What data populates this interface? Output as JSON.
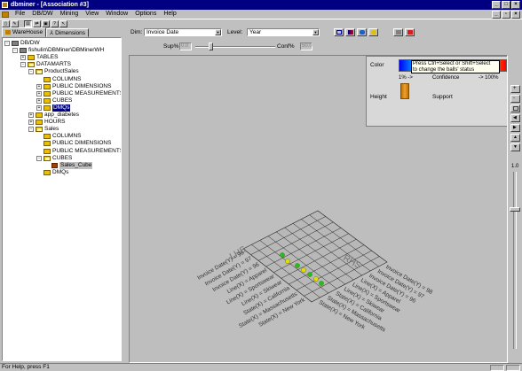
{
  "window": {
    "title": "dbminer - [Association #3]"
  },
  "menu": [
    "File",
    "DB/DW",
    "Mining",
    "View",
    "Window",
    "Options",
    "Help"
  ],
  "left_tabs": [
    "WareHouse",
    "Dimensions"
  ],
  "tree": [
    {
      "label": "DB/DW",
      "indent": 0,
      "exp": "-",
      "icon": "db"
    },
    {
      "label": "fishulin\\DBMiner\\DBMinerWH",
      "indent": 1,
      "exp": "-",
      "icon": "db"
    },
    {
      "label": "TABLES",
      "indent": 2,
      "exp": "+",
      "icon": "folder"
    },
    {
      "label": "DATAMARTS",
      "indent": 2,
      "exp": "-",
      "icon": "folder"
    },
    {
      "label": "ProductSales",
      "indent": 3,
      "exp": "-",
      "icon": "folder"
    },
    {
      "label": "COLUMNS",
      "indent": 4,
      "exp": "",
      "icon": "folder"
    },
    {
      "label": "PUBLIC DIMENSIONS",
      "indent": 4,
      "exp": "+",
      "icon": "folder"
    },
    {
      "label": "PUBLIC MEASUREMENTS",
      "indent": 4,
      "exp": "+",
      "icon": "folder"
    },
    {
      "label": "CUBES",
      "indent": 4,
      "exp": "+",
      "icon": "folder"
    },
    {
      "label": "DMQs",
      "indent": 4,
      "exp": "+",
      "icon": "folder",
      "state": "selected"
    },
    {
      "label": "app_diabetes",
      "indent": 3,
      "exp": "+",
      "icon": "folder"
    },
    {
      "label": "HOURS",
      "indent": 3,
      "exp": "+",
      "icon": "folder"
    },
    {
      "label": "Sales",
      "indent": 3,
      "exp": "-",
      "icon": "folder"
    },
    {
      "label": "COLUMNS",
      "indent": 4,
      "exp": "",
      "icon": "folder"
    },
    {
      "label": "PUBLIC DIMENSIONS",
      "indent": 4,
      "exp": "",
      "icon": "folder"
    },
    {
      "label": "PUBLIC MEASUREMENTS",
      "indent": 4,
      "exp": "",
      "icon": "folder"
    },
    {
      "label": "CUBES",
      "indent": 4,
      "exp": "-",
      "icon": "folder"
    },
    {
      "label": "Sales_Cube",
      "indent": 5,
      "exp": "",
      "icon": "cube",
      "state": "grayed"
    },
    {
      "label": "DMQs",
      "indent": 4,
      "exp": "",
      "icon": "folder"
    }
  ],
  "controls": {
    "dim_label": "Dim:",
    "dim_value": "Invoice Date",
    "level_label": "Level:",
    "level_value": "Year",
    "sup_label": "Sup%",
    "sup_value": "0.0",
    "conf_label": "Conf%",
    "conf_value": "50.0"
  },
  "legend": {
    "color_label": "Color",
    "tooltip_line1": "Press Ctrl+Select or Shift+Select",
    "tooltip_line2": "to change the balls' status",
    "pct_low": "1% ->",
    "confidence": "Confidence",
    "pct_high": "-> 100%",
    "height_label": "Height",
    "support_label": "Support"
  },
  "plot": {
    "lhs_label": "LHS",
    "rhs_label": "RHS",
    "lhs_items": [
      "Invoice Date(Y) = 98",
      "Invoice Date(Y) = 97",
      "Invoice Date(Y) = 96",
      "Line(X) = Apparel",
      "Line(X) = Sportswear",
      "Line(X) = Skiwear",
      "State(X) = California",
      "State(X) = Massachusetts",
      "State(X) = New York"
    ],
    "rhs_items": [
      "Invoice Date(Y) = 98",
      "Invoice Date(Y) = 97",
      "Invoice Date(Y) = 96",
      "Line(X) = Apparel",
      "Line(X) = Sportswear",
      "Line(X) = Skiwear",
      "State(X) = California",
      "State(X) = Massachusetts",
      "State(X) = New York"
    ]
  },
  "right_scale_label": "1.0",
  "status_text": "For Help, press F1",
  "colors": {
    "title_bg": "#000080",
    "selected": "#000080",
    "ball": "#c8e000",
    "ball_green": "#20c020"
  }
}
